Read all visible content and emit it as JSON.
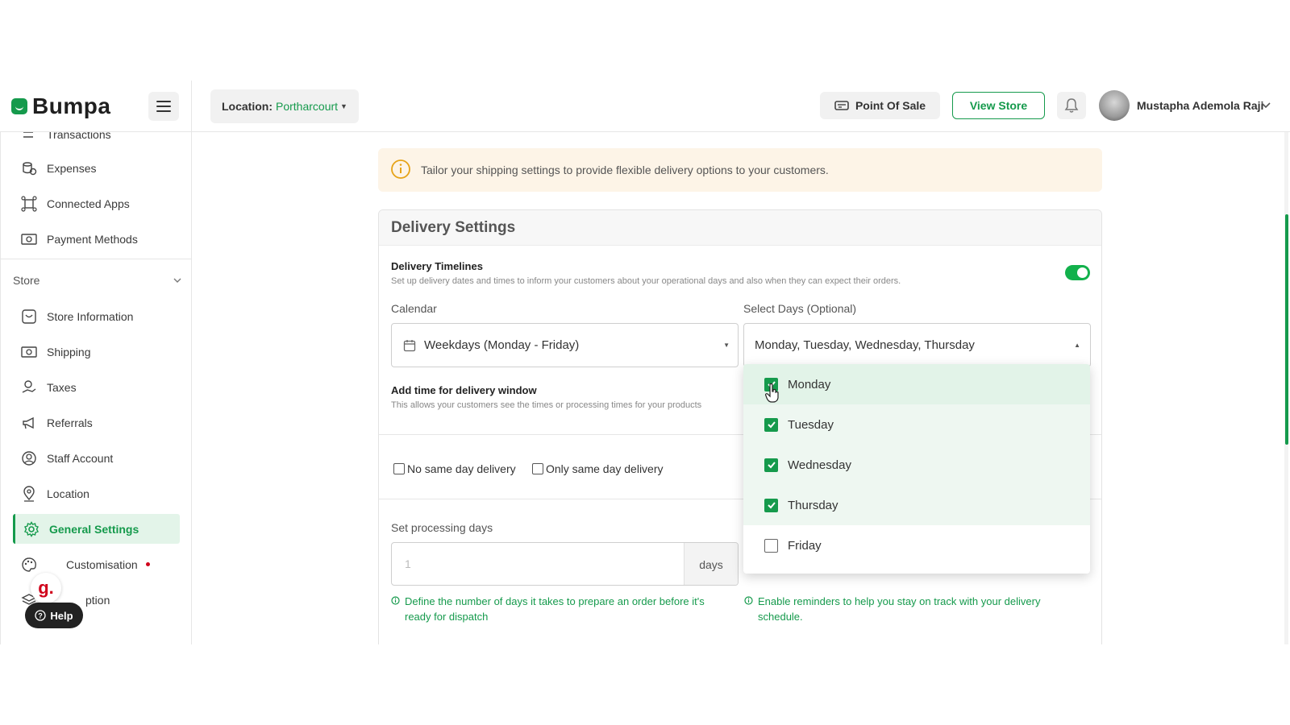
{
  "topbar": {
    "logo": "Bumpa",
    "location_label": "Location:",
    "location_value": "Portharcourt",
    "pos_label": "Point Of Sale",
    "view_store_label": "View Store",
    "user_name": "Mustapha Ademola Raji"
  },
  "sidebar": {
    "items_top": [
      {
        "label": "Transactions",
        "icon": "arrows-icon"
      },
      {
        "label": "Expenses",
        "icon": "coins-icon"
      },
      {
        "label": "Connected Apps",
        "icon": "apps-icon"
      },
      {
        "label": "Payment Methods",
        "icon": "money-icon"
      }
    ],
    "section_label": "Store",
    "items_store": [
      {
        "label": "Store Information",
        "icon": "store-icon"
      },
      {
        "label": "Shipping",
        "icon": "money-icon"
      },
      {
        "label": "Taxes",
        "icon": "tax-icon"
      },
      {
        "label": "Referrals",
        "icon": "megaphone-icon"
      },
      {
        "label": "Staff Account",
        "icon": "user-circle-icon"
      },
      {
        "label": "Location",
        "icon": "pin-icon"
      },
      {
        "label": "General Settings",
        "icon": "gear-icon",
        "active": true
      },
      {
        "label": "Customisation",
        "icon": "palette-icon"
      },
      {
        "label": "ption",
        "icon": "layers-icon"
      }
    ],
    "help_label": "Help",
    "g_badge": "g."
  },
  "banner": {
    "text": "Tailor your shipping settings to provide flexible delivery options to your customers."
  },
  "delivery": {
    "title": "Delivery Settings",
    "timelines_title": "Delivery Timelines",
    "timelines_sub": "Set up delivery dates and times to inform your customers about your operational days and also when they can expect their orders.",
    "toggle_on": true,
    "calendar_label": "Calendar",
    "calendar_value": "Weekdays (Monday - Friday)",
    "select_days_label": "Select Days (Optional)",
    "select_days_value": "Monday, Tuesday, Wednesday, Thursday",
    "window_title": "Add time for delivery window",
    "window_sub": "This allows your customers see the times or processing times for your products",
    "no_same_day": "No same day delivery",
    "only_same_day": "Only same day delivery",
    "processing_label": "Set processing days",
    "processing_placeholder": "1",
    "processing_suffix": "days",
    "processing_help": "Define the number of days it takes to prepare an order before it's ready for dispatch",
    "reminder_help": "Enable reminders to help you stay on track with your delivery schedule."
  },
  "day_options": [
    {
      "label": "Monday",
      "checked": true
    },
    {
      "label": "Tuesday",
      "checked": true
    },
    {
      "label": "Wednesday",
      "checked": true
    },
    {
      "label": "Thursday",
      "checked": true
    },
    {
      "label": "Friday",
      "checked": false
    }
  ],
  "colors": {
    "accent": "#159a4c",
    "toggle": "#12b14c",
    "banner_bg": "#fdf4e7",
    "alert_dot": "#d0021b"
  }
}
